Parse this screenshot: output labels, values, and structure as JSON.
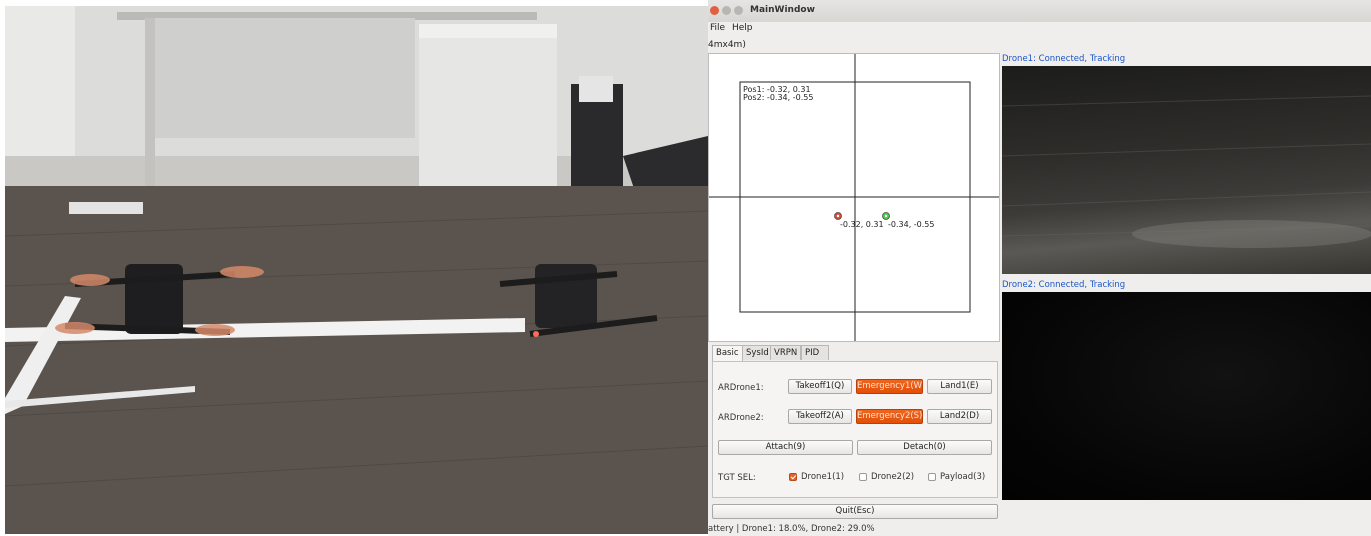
{
  "window": {
    "title": "MainWindow"
  },
  "menu": {
    "file": "File",
    "help": "Help"
  },
  "arena_label": "4mx4m)",
  "plot": {
    "pos_lines": [
      "Pos1: -0.32, 0.31",
      "Pos2: -0.34, -0.55"
    ],
    "drone1_coord": "-0.32, 0.31",
    "drone2_coord": "-0.34, -0.55",
    "drone1_color": "#e04a3a",
    "drone2_color": "#4ccc4c"
  },
  "tabs": [
    "Basic",
    "SysId",
    "VRPN",
    "PID Tune"
  ],
  "controls": {
    "ardrone1_label": "ARDrone1:",
    "ardrone2_label": "ARDrone2:",
    "takeoff1": "Takeoff1(Q)",
    "emergency1": "Emergency1(W)",
    "land1": "Land1(E)",
    "takeoff2": "Takeoff2(A)",
    "emergency2": "Emergency2(S)",
    "land2": "Land2(D)",
    "attach": "Attach(9)",
    "detach": "Detach(0)",
    "tgt_label": "TGT SEL:",
    "targets": [
      {
        "label": "Drone1(1)",
        "checked": true
      },
      {
        "label": "Drone2(2)",
        "checked": false
      },
      {
        "label": "Payload(3)",
        "checked": false
      }
    ],
    "quit": "Quit(Esc)",
    "emergency_color": "#e8560f"
  },
  "status_bar": "attery | Drone1: 18.0%, Drone2: 29.0%",
  "feeds": {
    "drone1": "Drone1: Connected, Tracking",
    "drone2": "Drone2: Connected, Tracking"
  }
}
